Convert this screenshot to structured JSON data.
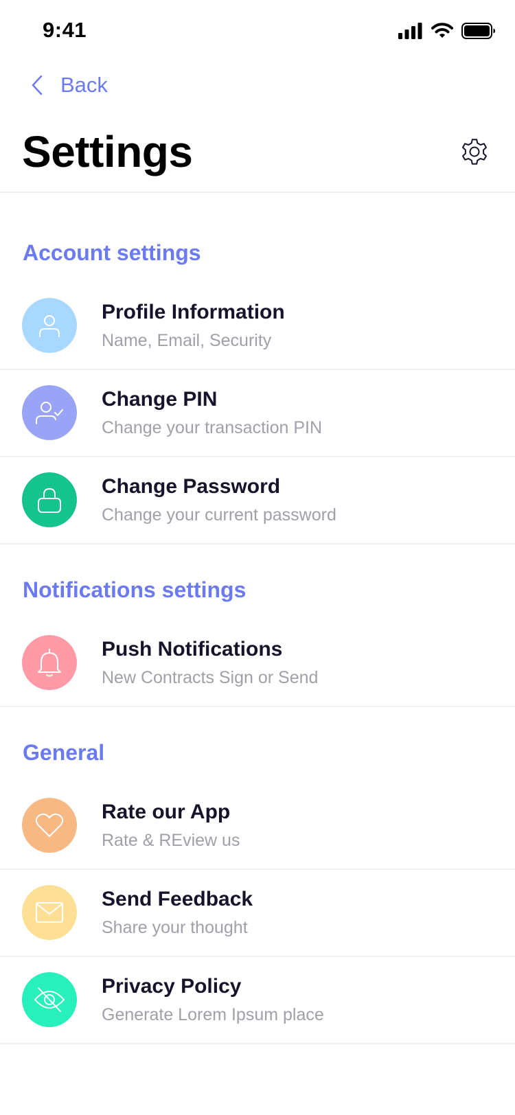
{
  "status": {
    "time": "9:41"
  },
  "nav": {
    "back_label": "Back"
  },
  "page": {
    "title": "Settings"
  },
  "sections": [
    {
      "title": "Account settings",
      "items": [
        {
          "title": "Profile Information",
          "subtitle": "Name, Email, Security",
          "icon": "user-icon",
          "color": "#a8d8ff"
        },
        {
          "title": "Change PIN",
          "subtitle": "Change your transaction PIN",
          "icon": "user-check-icon",
          "color": "#9aa4f6"
        },
        {
          "title": "Change Password",
          "subtitle": "Change your current password",
          "icon": "lock-icon",
          "color": "#14c48c"
        }
      ]
    },
    {
      "title": "Notifications settings",
      "items": [
        {
          "title": "Push Notifications",
          "subtitle": "New Contracts Sign or Send",
          "icon": "bell-icon",
          "color": "#ff9aa6"
        }
      ]
    },
    {
      "title": "General",
      "items": [
        {
          "title": "Rate our App",
          "subtitle": "Rate & REview us",
          "icon": "heart-icon",
          "color": "#f7b984"
        },
        {
          "title": "Send Feedback",
          "subtitle": "Share your thought",
          "icon": "mail-icon",
          "color": "#fde095"
        },
        {
          "title": "Privacy Policy",
          "subtitle": "Generate Lorem Ipsum place",
          "icon": "eye-off-icon",
          "color": "#28f0bd"
        }
      ]
    }
  ]
}
